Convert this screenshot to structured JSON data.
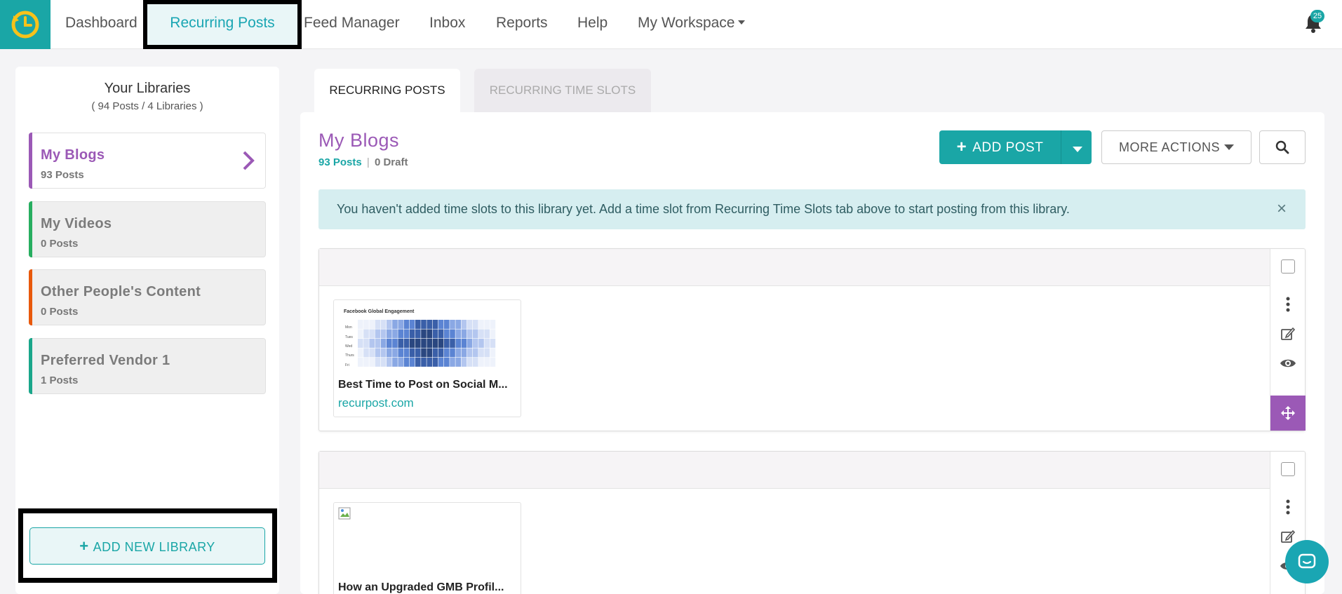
{
  "nav": {
    "items": [
      {
        "label": "Dashboard"
      },
      {
        "label": "Recurring Posts"
      },
      {
        "label": "Feed Manager"
      },
      {
        "label": "Inbox"
      },
      {
        "label": "Reports"
      },
      {
        "label": "Help"
      },
      {
        "label": "My Workspace"
      }
    ],
    "notification_count": "25",
    "icons": [
      "logo-clock-icon",
      "bell-icon"
    ]
  },
  "sidebar": {
    "title": "Your Libraries",
    "subtitle": "( 94 Posts / 4 Libraries )",
    "libraries": [
      {
        "name": "My Blogs",
        "count": "93 Posts",
        "color": "#9b59b6"
      },
      {
        "name": "My Videos",
        "count": "0 Posts",
        "color": "#27ae60"
      },
      {
        "name": "Other People's Content",
        "count": "0 Posts",
        "color": "#e8590c"
      },
      {
        "name": "Preferred Vendor 1",
        "count": "1 Posts",
        "color": "#1aa68a"
      }
    ],
    "add_library_label": "ADD NEW LIBRARY"
  },
  "tabs": [
    {
      "label": "RECURRING POSTS"
    },
    {
      "label": "RECURRING TIME SLOTS"
    }
  ],
  "main": {
    "library_title": "My Blogs",
    "posts_count": "93 Posts",
    "separator": "|",
    "draft_count": "0 Draft",
    "add_post_label": "ADD POST",
    "more_actions_label": "MORE ACTIONS",
    "alert_text": "You haven't added time slots to this library yet. Add a time slot from Recurring Time Slots tab above to start posting from this library.",
    "alert_close": "×",
    "posts": [
      {
        "title": "Best Time to Post on Social M...",
        "link": "recurpost.com",
        "image_caption": "Facebook Global Engagement",
        "row_labels": [
          "Mon",
          "Tues",
          "Wed",
          "Thurs",
          "Fri"
        ]
      },
      {
        "title": "How an Upgraded GMB Profil...",
        "link": ""
      }
    ]
  },
  "colors": {
    "brand": "#1aa6a6",
    "library_accent": "#9b59b6",
    "alert_bg": "#d6eef0"
  }
}
